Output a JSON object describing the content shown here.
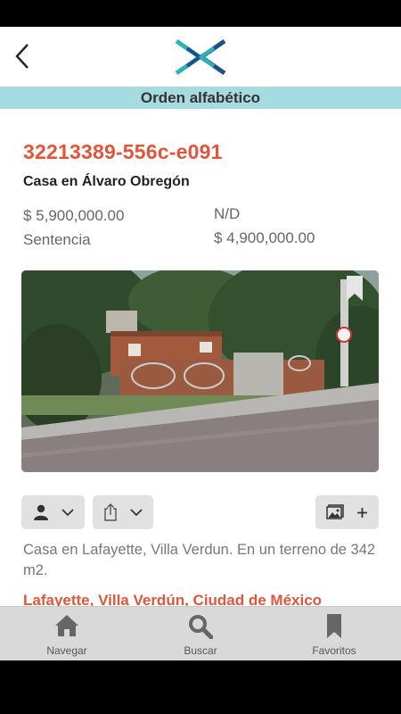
{
  "header": {
    "sort_label": "Orden alfabético"
  },
  "property": {
    "id": "32213389-556c-e091",
    "title": "Casa en Álvaro Obregón",
    "price": "$ 5,900,000.00",
    "status": "Sentencia",
    "nd": "N/D",
    "price2": "$ 4,900,000.00",
    "description": "Casa en Lafayette, Villa Verdun. En un terreno de 342 m2.",
    "location": "Lafayette, Villa Verdún, Ciudad de México"
  },
  "tabs": [
    {
      "label": "Navegar",
      "icon": "home-icon"
    },
    {
      "label": "Buscar",
      "icon": "search-icon"
    },
    {
      "label": "Favoritos",
      "icon": "bookmark-icon"
    }
  ],
  "colors": {
    "accent": "#e0553b",
    "sort_bar": "#a7dbe2",
    "tabbar": "#d9d9d9"
  }
}
